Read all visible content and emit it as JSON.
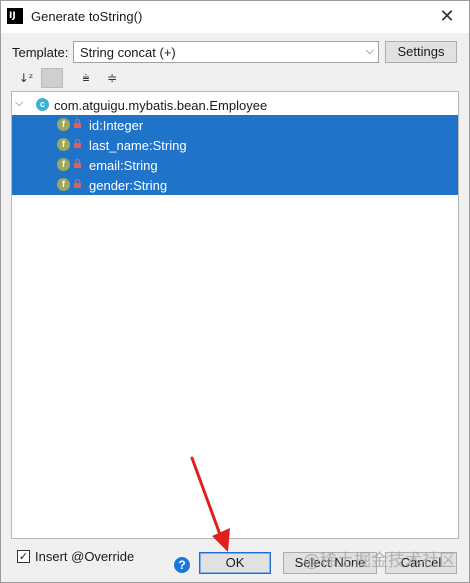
{
  "window": {
    "title": "Generate toString()",
    "app_icon_text": "IJ"
  },
  "template": {
    "label": "Template:",
    "value": "String concat (+)",
    "settings_label": "Settings"
  },
  "toolbar": {
    "icons": [
      "sort-alpha-icon",
      "sort-toggle-icon",
      "expand-all-icon",
      "collapse-all-icon"
    ]
  },
  "tree": {
    "root": {
      "badge": "c",
      "label": "com.atguigu.mybatis.bean.Employee"
    },
    "fields": [
      {
        "badge": "f",
        "label": "id:Integer"
      },
      {
        "badge": "f",
        "label": "last_name:String"
      },
      {
        "badge": "f",
        "label": "email:String"
      },
      {
        "badge": "f",
        "label": "gender:String"
      }
    ]
  },
  "footer": {
    "insert_override": {
      "label": "Insert @Override",
      "checked": true
    },
    "ok_label": "OK",
    "select_none_label": "Select None",
    "cancel_label": "Cancel"
  },
  "colors": {
    "selection": "#1f73c8",
    "class_badge": "#3db0d6",
    "field_badge": "#9ea85a",
    "arrow": "#e0201c"
  },
  "watermark": "@稀土掘金技术社区"
}
